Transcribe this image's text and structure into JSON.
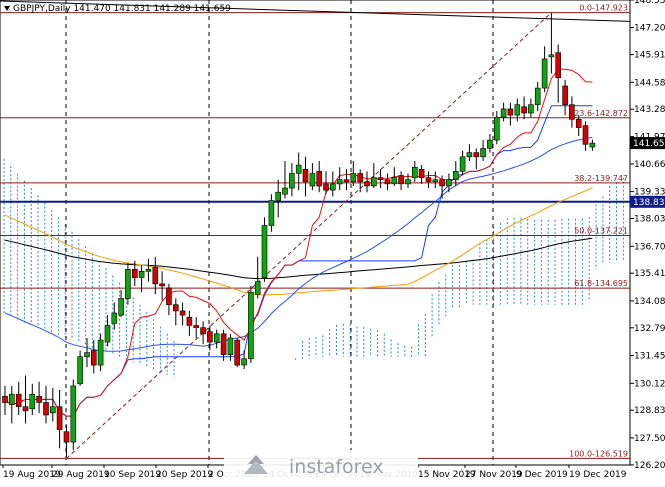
{
  "header": {
    "symbol_line": "GBPJPY,Daily  141.470 141.831 141.289 141.659"
  },
  "watermark": {
    "text": "instaforex",
    "color": "#9aa0a8"
  },
  "colors": {
    "background": "#ffffff",
    "bull_candle": "#11a311",
    "bear_candle": "#d40000",
    "fib_line": "#8b1a1a",
    "tenkan": "#e01010",
    "kijun": "#1c3cff",
    "ma_slow": "#000000",
    "ma_orange": "#f0a000",
    "ma_blue": "#2b50f0",
    "hline_blue": "#0b1b8a",
    "cloud_blue": "#2a8ad4",
    "cloud_red": "#c02020",
    "current_price_bg": "#000000"
  },
  "chart_data": {
    "type": "candlestick",
    "symbol": "GBPJPY",
    "timeframe": "Daily",
    "last_bar": {
      "open": 141.47,
      "high": 141.831,
      "low": 141.289,
      "close": 141.659
    },
    "current_price": 141.659,
    "ylim": [
      126.2,
      148.53
    ],
    "y_ticks": [
      "148.530",
      "147.205",
      "145.910",
      "144.580",
      "143.285",
      "141.970",
      "140.660",
      "139.330",
      "138.035",
      "136.700",
      "135.410",
      "134.080",
      "132.790",
      "131.455",
      "130.125",
      "128.830",
      "127.500",
      "126.205"
    ],
    "x_ticks": [
      "19 Aug 2019",
      "29 Aug 2019",
      "10 Sep 2019",
      "20 Sep 2019",
      "2 Oct 2019",
      "14 Oct 2019",
      "24 Oct 2019",
      "5 Nov 2019",
      "15 Nov 2019",
      "27 Nov 2019",
      "9 Dec 2019",
      "19 Dec 2019"
    ],
    "fib_levels": [
      {
        "label": "0.0-147.923",
        "price": 147.923
      },
      {
        "label": "23.6-142.872",
        "price": 142.872
      },
      {
        "label": "38.2-139.747",
        "price": 139.747
      },
      {
        "label": "50.0-137.221",
        "price": 137.221
      },
      {
        "label": "61.8-134.695",
        "price": 134.695
      },
      {
        "label": "100.0-126.519",
        "price": 126.519
      }
    ],
    "hline": {
      "label": "138.838",
      "price": 138.838
    },
    "candles": [
      [
        129.5,
        129.2,
        130.0,
        128.6
      ],
      [
        129.1,
        129.6,
        130.0,
        128.2
      ],
      [
        129.6,
        129.0,
        130.2,
        128.6
      ],
      [
        129.0,
        128.8,
        130.5,
        128.2
      ],
      [
        128.9,
        129.6,
        130.1,
        128.6
      ],
      [
        129.5,
        129.2,
        130.2,
        128.7
      ],
      [
        129.2,
        128.6,
        130.0,
        128.2
      ],
      [
        128.7,
        129.0,
        129.9,
        128.3
      ],
      [
        129.0,
        127.9,
        129.8,
        127.0
      ],
      [
        127.8,
        127.3,
        128.1,
        126.6
      ],
      [
        127.3,
        130.0,
        130.3,
        126.9
      ],
      [
        130.1,
        131.4,
        131.7,
        130.0
      ],
      [
        131.4,
        131.6,
        132.3,
        130.9
      ],
      [
        131.7,
        131.0,
        132.2,
        130.6
      ],
      [
        131.0,
        132.2,
        132.5,
        130.7
      ],
      [
        132.1,
        132.9,
        133.4,
        131.9
      ],
      [
        133.0,
        133.5,
        134.0,
        132.7
      ],
      [
        133.4,
        134.2,
        134.6,
        133.3
      ],
      [
        134.2,
        135.6,
        135.9,
        133.9
      ],
      [
        135.6,
        135.2,
        136.0,
        134.8
      ],
      [
        135.2,
        135.5,
        135.8,
        134.5
      ],
      [
        135.5,
        135.6,
        136.1,
        135.0
      ],
      [
        135.7,
        134.9,
        136.2,
        134.4
      ],
      [
        134.9,
        134.8,
        135.5,
        134.1
      ],
      [
        134.7,
        133.9,
        134.9,
        133.4
      ],
      [
        133.9,
        133.6,
        134.2,
        132.9
      ],
      [
        133.6,
        133.4,
        134.0,
        132.9
      ],
      [
        133.3,
        132.9,
        133.6,
        132.4
      ],
      [
        132.9,
        132.8,
        133.3,
        132.3
      ],
      [
        132.8,
        132.5,
        133.1,
        132.0
      ],
      [
        132.6,
        132.1,
        132.9,
        131.7
      ],
      [
        132.1,
        132.5,
        132.7,
        131.8
      ],
      [
        132.5,
        131.5,
        132.7,
        131.2
      ],
      [
        131.5,
        132.3,
        132.5,
        131.2
      ],
      [
        132.2,
        131.0,
        132.3,
        130.9
      ],
      [
        131.0,
        131.3,
        131.7,
        130.8
      ],
      [
        131.3,
        134.5,
        134.8,
        131.1
      ],
      [
        134.4,
        135.0,
        136.2,
        134.2
      ],
      [
        135.2,
        137.7,
        138.1,
        135.0
      ],
      [
        137.7,
        138.9,
        139.2,
        137.4
      ],
      [
        138.9,
        139.3,
        139.9,
        138.1
      ],
      [
        139.2,
        139.5,
        140.8,
        139.0
      ],
      [
        139.5,
        140.2,
        140.7,
        139.1
      ],
      [
        140.2,
        140.6,
        141.2,
        139.4
      ],
      [
        140.4,
        139.8,
        141.0,
        139.1
      ],
      [
        139.6,
        140.2,
        140.7,
        139.4
      ],
      [
        140.3,
        139.6,
        140.8,
        139.3
      ],
      [
        139.7,
        139.4,
        140.3,
        139.2
      ],
      [
        139.4,
        139.7,
        140.3,
        139.1
      ],
      [
        139.7,
        139.9,
        140.5,
        139.4
      ],
      [
        139.9,
        139.8,
        140.4,
        139.4
      ],
      [
        139.8,
        140.2,
        140.8,
        139.6
      ],
      [
        140.2,
        139.8,
        140.4,
        139.3
      ],
      [
        139.8,
        139.6,
        140.3,
        139.3
      ],
      [
        139.6,
        140.0,
        140.7,
        139.5
      ],
      [
        140.0,
        139.9,
        140.4,
        139.5
      ],
      [
        139.9,
        139.7,
        140.2,
        139.4
      ],
      [
        139.7,
        140.0,
        140.5,
        139.6
      ],
      [
        140.1,
        139.7,
        140.3,
        139.4
      ],
      [
        139.7,
        139.9,
        140.2,
        139.5
      ],
      [
        140.0,
        140.5,
        140.8,
        139.8
      ],
      [
        140.4,
        140.0,
        140.6,
        139.7
      ],
      [
        140.0,
        139.8,
        140.3,
        139.5
      ],
      [
        139.8,
        139.9,
        140.3,
        139.5
      ],
      [
        139.9,
        139.6,
        140.1,
        139.0
      ],
      [
        139.6,
        139.9,
        140.2,
        139.3
      ],
      [
        139.9,
        140.3,
        140.8,
        139.6
      ],
      [
        140.3,
        141.0,
        141.3,
        140.1
      ],
      [
        141.0,
        141.2,
        141.6,
        140.8
      ],
      [
        141.2,
        141.0,
        141.4,
        140.4
      ],
      [
        141.0,
        141.4,
        141.8,
        140.8
      ],
      [
        141.4,
        141.8,
        142.1,
        141.2
      ],
      [
        141.8,
        142.9,
        143.2,
        141.6
      ],
      [
        142.9,
        143.3,
        143.6,
        142.7
      ],
      [
        143.3,
        143.0,
        143.6,
        142.5
      ],
      [
        143.0,
        143.5,
        143.8,
        142.7
      ],
      [
        143.4,
        143.1,
        143.9,
        142.8
      ],
      [
        143.1,
        143.5,
        143.8,
        142.9
      ],
      [
        143.5,
        144.3,
        144.6,
        143.2
      ],
      [
        144.3,
        145.7,
        146.3,
        144.1
      ],
      [
        145.8,
        145.9,
        147.9,
        145.0
      ],
      [
        146.0,
        144.8,
        146.4,
        143.6
      ],
      [
        144.4,
        143.5,
        144.7,
        143.0
      ],
      [
        143.5,
        142.8,
        143.9,
        142.4
      ],
      [
        142.8,
        142.4,
        143.0,
        142.0
      ],
      [
        142.5,
        141.6,
        142.7,
        141.3
      ],
      [
        141.47,
        141.659,
        141.831,
        141.289
      ]
    ]
  }
}
